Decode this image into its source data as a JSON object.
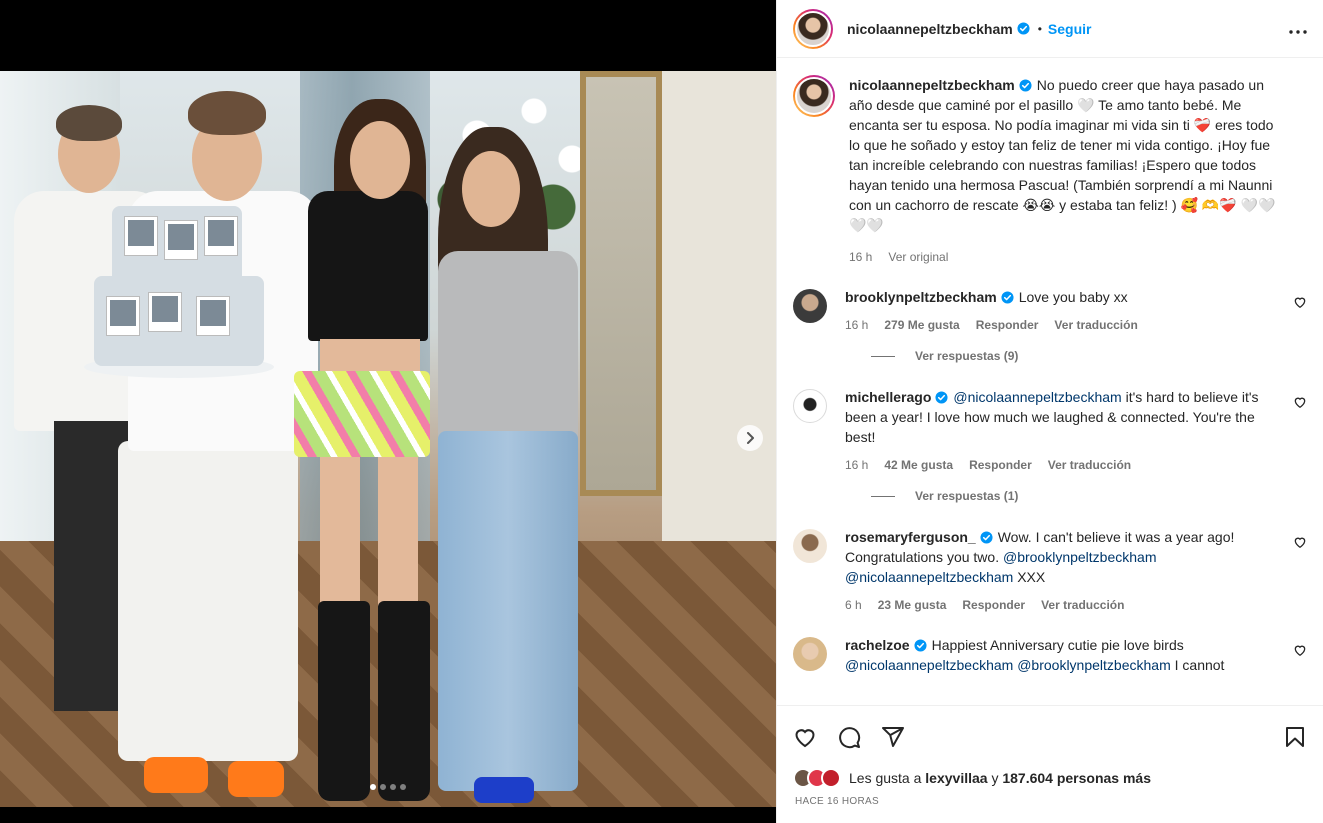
{
  "post": {
    "author": "nicolaannepeltzbeckham",
    "follow_label": "Seguir",
    "separator": "•",
    "caption": "No puedo creer que haya pasado un año desde que caminé por el pasillo 🤍 Te amo tanto bebé. Me encanta ser tu esposa. No podía imaginar mi vida sin ti ❤️‍🩹 eres todo lo que he soñado y estoy tan feliz de tener mi vida contigo. ¡Hoy fue tan increíble celebrando con nuestras familias! ¡Espero que todos hayan tenido una hermosa Pascua! (También sorprendí a mi Naunni con un cachorro de rescate 😭😭 y estaba tan feliz! ) 🥰 🫶❤️‍🩹 🤍🤍🤍🤍",
    "caption_time": "16 h",
    "see_original": "Ver original",
    "likes_prefix": "Les gusta a",
    "likes_user": "lexyvillaa",
    "likes_suffix": "y",
    "likes_count": "187.604 personas más",
    "posted_ago": "HACE 16 HORAS"
  },
  "comments": [
    {
      "user": "brooklynpeltzbeckham",
      "text": "Love you baby xx",
      "time": "16 h",
      "likes": "279 Me gusta",
      "reply": "Responder",
      "translate": "Ver traducción",
      "replies": "Ver respuestas (9)"
    },
    {
      "user": "michellerago",
      "mention": "@nicolaannepeltzbeckham",
      "text": "it's hard to believe it's been a year! I love how much we laughed & connected. You're the best!",
      "time": "16 h",
      "likes": "42 Me gusta",
      "reply": "Responder",
      "translate": "Ver traducción",
      "replies": "Ver respuestas (1)"
    },
    {
      "user": "rosemaryferguson_",
      "text": "Wow. I can't believe it was a year ago! Congratulations you two.",
      "mention1": "@brooklynpeltzbeckham",
      "mention2": "@nicolaannepeltzbeckham",
      "text2": "XXX",
      "time": "6 h",
      "likes": "23 Me gusta",
      "reply": "Responder",
      "translate": "Ver traducción"
    },
    {
      "user": "rachelzoe",
      "text": "Happiest Anniversary cutie pie love birds",
      "mention1": "@nicolaannepeltzbeckham",
      "mention2": "@brooklynpeltzbeckham",
      "text2": "I cannot"
    }
  ],
  "icons": {
    "more": "more-horizontal-icon",
    "like": "heart-icon",
    "comment": "comment-icon",
    "share": "share-icon",
    "save": "bookmark-icon",
    "next": "chevron-right-icon",
    "verified": "verified-badge-icon"
  },
  "carousel": {
    "total": 4,
    "active_index": 0
  },
  "colors": {
    "accent": "#0095f6",
    "verified": "#0095f6",
    "mention": "#00376b",
    "muted": "#737373"
  }
}
